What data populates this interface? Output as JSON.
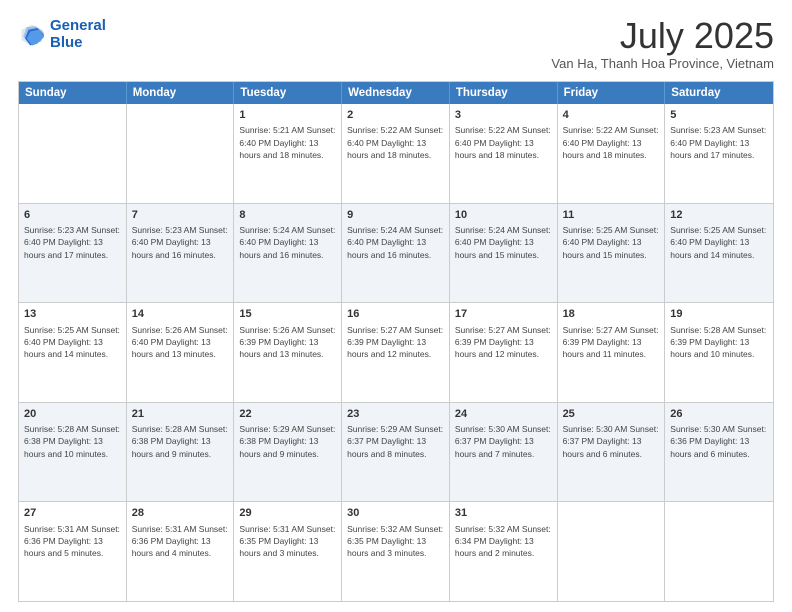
{
  "header": {
    "logo_line1": "General",
    "logo_line2": "Blue",
    "title": "July 2025",
    "subtitle": "Van Ha, Thanh Hoa Province, Vietnam"
  },
  "days_of_week": [
    "Sunday",
    "Monday",
    "Tuesday",
    "Wednesday",
    "Thursday",
    "Friday",
    "Saturday"
  ],
  "weeks": [
    [
      {
        "day": "",
        "info": ""
      },
      {
        "day": "",
        "info": ""
      },
      {
        "day": "1",
        "info": "Sunrise: 5:21 AM\nSunset: 6:40 PM\nDaylight: 13 hours and 18 minutes."
      },
      {
        "day": "2",
        "info": "Sunrise: 5:22 AM\nSunset: 6:40 PM\nDaylight: 13 hours and 18 minutes."
      },
      {
        "day": "3",
        "info": "Sunrise: 5:22 AM\nSunset: 6:40 PM\nDaylight: 13 hours and 18 minutes."
      },
      {
        "day": "4",
        "info": "Sunrise: 5:22 AM\nSunset: 6:40 PM\nDaylight: 13 hours and 18 minutes."
      },
      {
        "day": "5",
        "info": "Sunrise: 5:23 AM\nSunset: 6:40 PM\nDaylight: 13 hours and 17 minutes."
      }
    ],
    [
      {
        "day": "6",
        "info": "Sunrise: 5:23 AM\nSunset: 6:40 PM\nDaylight: 13 hours and 17 minutes."
      },
      {
        "day": "7",
        "info": "Sunrise: 5:23 AM\nSunset: 6:40 PM\nDaylight: 13 hours and 16 minutes."
      },
      {
        "day": "8",
        "info": "Sunrise: 5:24 AM\nSunset: 6:40 PM\nDaylight: 13 hours and 16 minutes."
      },
      {
        "day": "9",
        "info": "Sunrise: 5:24 AM\nSunset: 6:40 PM\nDaylight: 13 hours and 16 minutes."
      },
      {
        "day": "10",
        "info": "Sunrise: 5:24 AM\nSunset: 6:40 PM\nDaylight: 13 hours and 15 minutes."
      },
      {
        "day": "11",
        "info": "Sunrise: 5:25 AM\nSunset: 6:40 PM\nDaylight: 13 hours and 15 minutes."
      },
      {
        "day": "12",
        "info": "Sunrise: 5:25 AM\nSunset: 6:40 PM\nDaylight: 13 hours and 14 minutes."
      }
    ],
    [
      {
        "day": "13",
        "info": "Sunrise: 5:25 AM\nSunset: 6:40 PM\nDaylight: 13 hours and 14 minutes."
      },
      {
        "day": "14",
        "info": "Sunrise: 5:26 AM\nSunset: 6:40 PM\nDaylight: 13 hours and 13 minutes."
      },
      {
        "day": "15",
        "info": "Sunrise: 5:26 AM\nSunset: 6:39 PM\nDaylight: 13 hours and 13 minutes."
      },
      {
        "day": "16",
        "info": "Sunrise: 5:27 AM\nSunset: 6:39 PM\nDaylight: 13 hours and 12 minutes."
      },
      {
        "day": "17",
        "info": "Sunrise: 5:27 AM\nSunset: 6:39 PM\nDaylight: 13 hours and 12 minutes."
      },
      {
        "day": "18",
        "info": "Sunrise: 5:27 AM\nSunset: 6:39 PM\nDaylight: 13 hours and 11 minutes."
      },
      {
        "day": "19",
        "info": "Sunrise: 5:28 AM\nSunset: 6:39 PM\nDaylight: 13 hours and 10 minutes."
      }
    ],
    [
      {
        "day": "20",
        "info": "Sunrise: 5:28 AM\nSunset: 6:38 PM\nDaylight: 13 hours and 10 minutes."
      },
      {
        "day": "21",
        "info": "Sunrise: 5:28 AM\nSunset: 6:38 PM\nDaylight: 13 hours and 9 minutes."
      },
      {
        "day": "22",
        "info": "Sunrise: 5:29 AM\nSunset: 6:38 PM\nDaylight: 13 hours and 9 minutes."
      },
      {
        "day": "23",
        "info": "Sunrise: 5:29 AM\nSunset: 6:37 PM\nDaylight: 13 hours and 8 minutes."
      },
      {
        "day": "24",
        "info": "Sunrise: 5:30 AM\nSunset: 6:37 PM\nDaylight: 13 hours and 7 minutes."
      },
      {
        "day": "25",
        "info": "Sunrise: 5:30 AM\nSunset: 6:37 PM\nDaylight: 13 hours and 6 minutes."
      },
      {
        "day": "26",
        "info": "Sunrise: 5:30 AM\nSunset: 6:36 PM\nDaylight: 13 hours and 6 minutes."
      }
    ],
    [
      {
        "day": "27",
        "info": "Sunrise: 5:31 AM\nSunset: 6:36 PM\nDaylight: 13 hours and 5 minutes."
      },
      {
        "day": "28",
        "info": "Sunrise: 5:31 AM\nSunset: 6:36 PM\nDaylight: 13 hours and 4 minutes."
      },
      {
        "day": "29",
        "info": "Sunrise: 5:31 AM\nSunset: 6:35 PM\nDaylight: 13 hours and 3 minutes."
      },
      {
        "day": "30",
        "info": "Sunrise: 5:32 AM\nSunset: 6:35 PM\nDaylight: 13 hours and 3 minutes."
      },
      {
        "day": "31",
        "info": "Sunrise: 5:32 AM\nSunset: 6:34 PM\nDaylight: 13 hours and 2 minutes."
      },
      {
        "day": "",
        "info": ""
      },
      {
        "day": "",
        "info": ""
      }
    ]
  ]
}
